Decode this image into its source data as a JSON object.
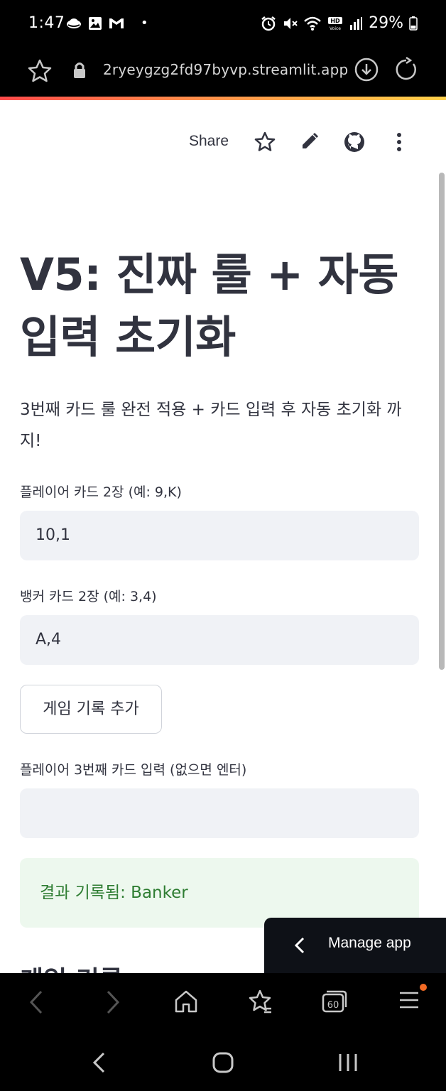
{
  "status_bar": {
    "time": "1:47",
    "dot": "•",
    "battery": "29%",
    "icons_left": [
      "weather-icon",
      "image-icon",
      "gmail-icon"
    ],
    "icons_right": [
      "alarm-icon",
      "mute-icon",
      "wifi-icon",
      "hd-voice-icon",
      "signal-icon",
      "battery-icon"
    ]
  },
  "browser": {
    "url": "2ryeygzg2fd97byvp.streamlit.app"
  },
  "toolbar": {
    "share_label": "Share"
  },
  "main": {
    "title": "V5: 진짜 룰 + 자동 입력 초기화",
    "subtitle": "3번째 카드 룰 완전 적용 + 카드 입력 후 자동 초기화 까지!",
    "player_label": "플레이어 카드 2장 (예: 9,K)",
    "player_value": "10,1",
    "banker_label": "뱅커 카드 2장 (예: 3,4)",
    "banker_value": "A,4",
    "add_button": "게임 기록 추가",
    "third_card_label": "플레이어 3번째 카드 입력 (없으면 엔터)",
    "third_card_value": "",
    "success_message": "결과 기록됨: Banker",
    "history_heading": "게임 기록"
  },
  "manage_app": {
    "label": "Manage app"
  },
  "colors": {
    "accent_red": "#ff4b4b",
    "input_bg": "#f0f2f6",
    "success_bg": "#edf8ee",
    "success_text": "#2e7d32",
    "text": "#31333f",
    "badge": "#f26a24"
  }
}
